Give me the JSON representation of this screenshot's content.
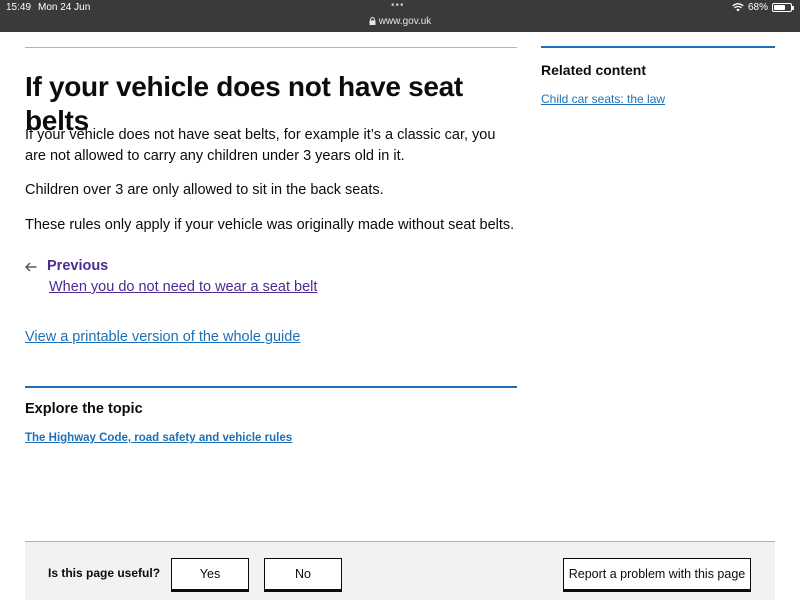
{
  "status_bar": {
    "time": "15:49",
    "date": "Mon 24 Jun",
    "dots": "•••",
    "url": "www.gov.uk",
    "battery": "68%",
    "battery_level": 0.68
  },
  "main": {
    "title": "If your vehicle does not have seat belts",
    "paragraphs": [
      "If your vehicle does not have seat belts, for example it’s a classic car, you are not allowed to carry any children under 3 years old in it.",
      "Children over 3 are only allowed to sit in the back seats.",
      "These rules only apply if your vehicle was originally made without seat belts."
    ],
    "previous": {
      "label": "Previous",
      "link": "When you do not need to wear a seat belt"
    },
    "print_link": "View a printable version of the whole guide"
  },
  "explore": {
    "heading": "Explore the topic",
    "link": "The Highway Code, road safety and vehicle rules"
  },
  "related": {
    "heading": "Related content",
    "link": "Child car seats: the law"
  },
  "feedback": {
    "question": "Is this page useful?",
    "yes": "Yes",
    "no": "No",
    "report": "Report a problem with this page"
  },
  "colors": {
    "link": "#1d70b8",
    "visited_link": "#4c2c92",
    "text": "#0b0c0c",
    "status_bar": "#3a3a3c"
  }
}
